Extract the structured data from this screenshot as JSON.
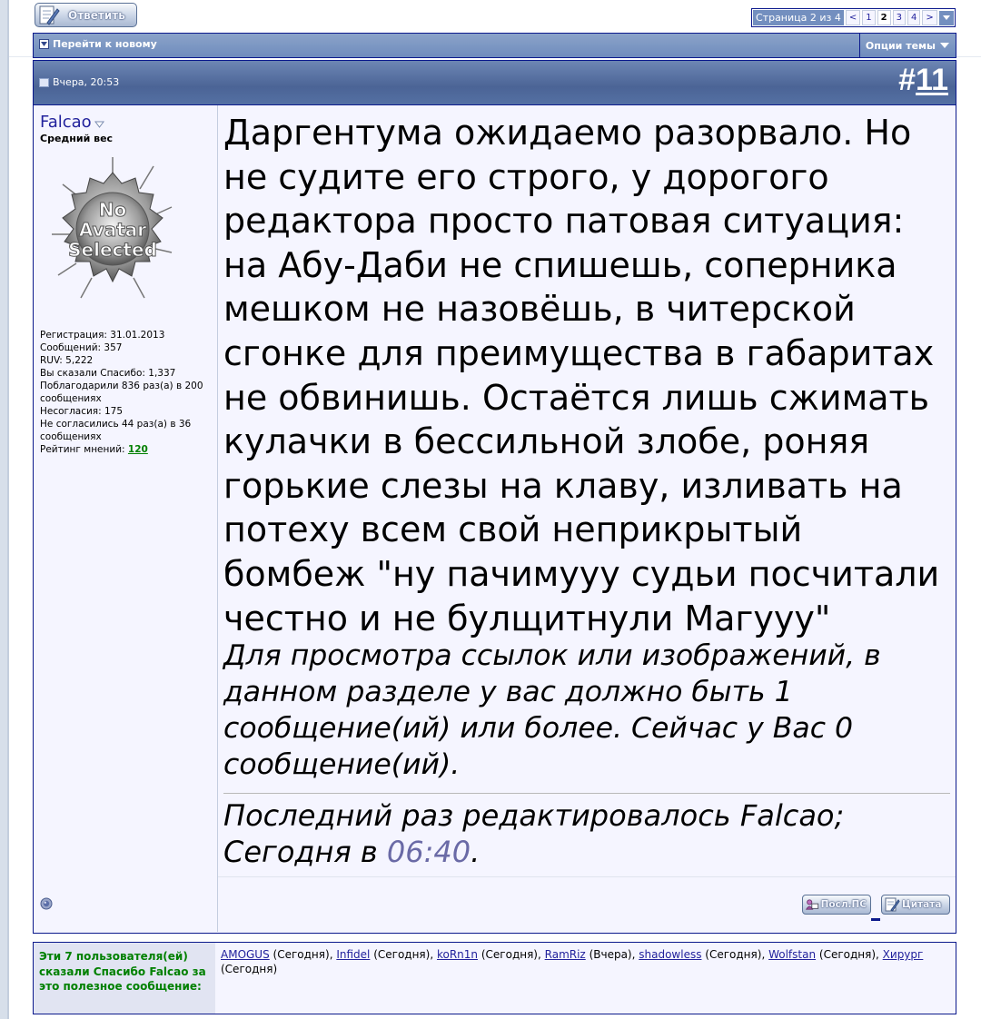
{
  "toolbar": {
    "reply_label": "Ответить"
  },
  "pagenav": {
    "label": "Страница 2 из 4",
    "prev": "<",
    "pages": [
      "1",
      "2",
      "3",
      "4"
    ],
    "current": "2",
    "next": ">"
  },
  "threadbar": {
    "goto_new": "Перейти к новому",
    "thread_options": "Опции темы"
  },
  "post": {
    "date": "Вчера, 20:53",
    "number_prefix": "#",
    "number": "11",
    "user": {
      "name": "Falcao",
      "title": "Средний вес",
      "avatar_text": [
        "No",
        "Avatar",
        "Selected"
      ],
      "stats": [
        "Регистрация: 31.01.2013",
        "Сообщений: 357",
        "RUV: 5,222",
        "Вы сказали Спасибо: 1,337",
        "Поблагодарили 836 раз(а) в 200 сообщениях",
        "Несогласия: 175",
        "Не согласились 44 раз(а) в 36 сообщениях"
      ],
      "rating_label": "Рейтинг мнений:",
      "rating_value": "120"
    },
    "message": "Даргентума ожидаемо разорвало. Но не судите его строго, у дорогого редактора просто патовая ситуация: на Абу-Даби не спишешь, соперника мешком не назовёшь, в читерской сгонке для преимущества в габаритах не обвинишь. Остаётся лишь сжимать кулачки в бессильной злобе, роняя горькие слезы на клаву, изливать на потеху всем свой неприкрытый бомбеж \"ну пачимууу судьи посчитали честно и не булщитнули Магууу\"",
    "hidden_notice": "Для просмотра ссылок или изображений, в данном разделе у вас должно быть 1 сообщение(ий) или более. Сейчас у Вас 0 сообщение(ий).",
    "edited_prefix": "Последний раз редактировалось Falcao; Сегодня в ",
    "edited_time": "06:40",
    "edited_suffix": ".",
    "buttons": {
      "pm": "Посл.ПС",
      "quote": "Цитата"
    }
  },
  "thanks": {
    "label": "Эти 7 пользователя(ей) сказали Спасибо Falcao за это полезное сообщение:",
    "users": [
      {
        "name": "AMOGUS",
        "when": "(Сегодня)"
      },
      {
        "name": "Infidel",
        "when": "(Сегодня)"
      },
      {
        "name": "koRn1n",
        "when": "(Сегодня)"
      },
      {
        "name": "RamRiz",
        "when": "(Вчера)"
      },
      {
        "name": "shadowless",
        "when": "(Сегодня)"
      },
      {
        "name": "Wolfstan",
        "when": "(Сегодня)"
      },
      {
        "name": "Хирург",
        "when": "(Сегодня)"
      }
    ]
  },
  "colors": {
    "border": "#0b198c",
    "header": "#738fbf",
    "post_bg": "#f5f5ff",
    "link": "#22229c",
    "thanks_green": "#008000"
  }
}
